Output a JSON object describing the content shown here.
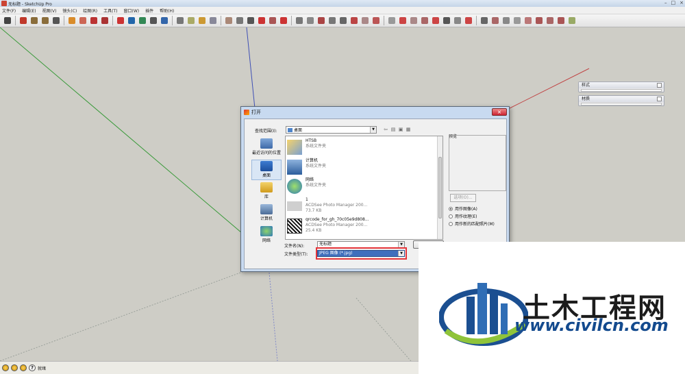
{
  "window": {
    "title": "无标题 - SketchUp Pro"
  },
  "menu": [
    "文件(F)",
    "编辑(E)",
    "视图(V)",
    "镜头(C)",
    "绘图(R)",
    "工具(T)",
    "窗口(W)",
    "插件",
    "帮助(H)"
  ],
  "panels": [
    {
      "title": "样式"
    },
    {
      "title": "材质"
    }
  ],
  "dialog": {
    "title": "打开",
    "look_in_label": "查找范围(I):",
    "look_in_value": "桌面",
    "places": [
      "最近访问的位置",
      "桌面",
      "库",
      "计算机",
      "网络"
    ],
    "files": [
      {
        "name": "HTSB",
        "line2": "系统文件夹",
        "line3": ""
      },
      {
        "name": "计算机",
        "line2": "系统文件夹",
        "line3": ""
      },
      {
        "name": "网络",
        "line2": "系统文件夹",
        "line3": ""
      },
      {
        "name": "1",
        "line2": "ACDSee Photo Manager 200...",
        "line3": "73.7 KB"
      },
      {
        "name": "qrcode_for_gh_70c05e9d808...",
        "line2": "ACDSee Photo Manager 200...",
        "line3": "25.4 KB"
      }
    ],
    "preview_label": "预览",
    "options_button": "选项(O)...",
    "radios": [
      "用作图像(A)",
      "用作纹理(E)",
      "用作新的匹配照片(M)"
    ],
    "radio_selected_index": 0,
    "filename_label": "文件名(N):",
    "filename_value": "无标题",
    "filetype_label": "文件类型(T):",
    "filetype_value": "JPEG 图像 (*.jpg)"
  },
  "status": {
    "text": "就绪"
  },
  "watermark": {
    "brand": "土木工程网",
    "url": "www.civilcn.com"
  },
  "colors": {
    "highlight": "#e5353a",
    "axis_green": "#3a9a3a",
    "axis_blue": "#3e4fb5",
    "axis_red": "#c04545",
    "brand_blue": "#134a8e"
  }
}
